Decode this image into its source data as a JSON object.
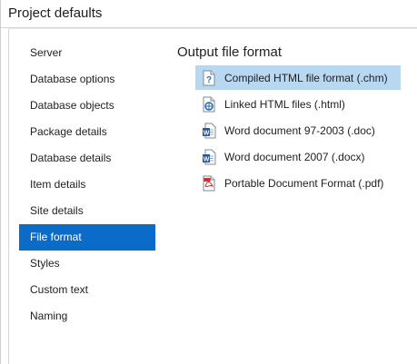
{
  "window": {
    "title": "Project defaults"
  },
  "nav": {
    "items": [
      {
        "label": "Server"
      },
      {
        "label": "Database options"
      },
      {
        "label": "Database objects"
      },
      {
        "label": "Package details"
      },
      {
        "label": "Database details"
      },
      {
        "label": "Item details"
      },
      {
        "label": "Site details"
      },
      {
        "label": "File format"
      },
      {
        "label": "Styles"
      },
      {
        "label": "Custom text"
      },
      {
        "label": "Naming"
      }
    ],
    "active": "File format"
  },
  "output": {
    "title": "Output file format",
    "formats": [
      {
        "label": "Compiled HTML file format (.chm)",
        "icon": "chm-help-icon",
        "selected": true
      },
      {
        "label": "Linked HTML files (.html)",
        "icon": "html-document-icon",
        "selected": false
      },
      {
        "label": "Word document 97-2003 (.doc)",
        "icon": "word-document-icon",
        "selected": false
      },
      {
        "label": "Word document 2007 (.docx)",
        "icon": "word-document-icon",
        "selected": false
      },
      {
        "label": "Portable Document Format (.pdf)",
        "icon": "pdf-document-icon",
        "selected": false
      }
    ]
  },
  "colors": {
    "accent": "#0a6bc8",
    "selection": "#b8d8f2"
  }
}
